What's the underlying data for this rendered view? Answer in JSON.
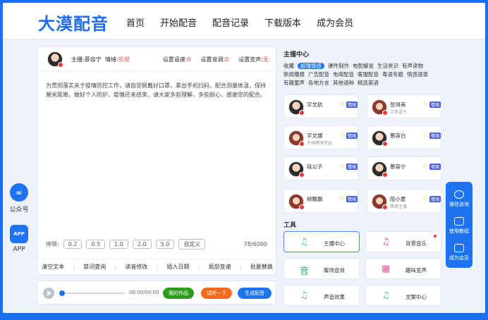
{
  "header": {
    "logo": "大漠配音",
    "nav": [
      "首页",
      "开始配音",
      "配音记录",
      "下载版本",
      "成为会员"
    ]
  },
  "left_side": [
    {
      "icon": "link-icon",
      "label": "公众号",
      "glyph": "∞"
    },
    {
      "icon": "app-icon",
      "label": "APP",
      "glyph": "APP"
    }
  ],
  "editor": {
    "anchor": "主播:慕容宁",
    "emotion_label": "情绪:",
    "emotion_value": "乐观",
    "speed_label": "设置语速:",
    "speed_value": "0",
    "tone_label": "设置音调:",
    "tone_value": "0",
    "vol_label": "设置变声:",
    "vol_value": "无",
    "text": "为贯彻落实关于疫情防控工作，请自觉佩戴好口罩，拿出手机扫码，配合测量体温，保持厘米距离，做好个人防护，疫情还未结束，请大家多些理解，多些耐心，感谢您的配合。",
    "pause_label": "停顿:",
    "pause_options": [
      "0.2",
      "0.5",
      "1.0",
      "2.0",
      "5.0",
      "自定义"
    ],
    "count": "78/6000",
    "tools": [
      "清空文本",
      "禁词查询",
      "读音修改",
      "插入日期",
      "局部变速",
      "批量替换"
    ]
  },
  "player": {
    "time": "00:00/00:00",
    "my_works": "我的作品",
    "try_listen": "试听一下",
    "generate": "生成配音"
  },
  "anchor_center": {
    "title": "主播中心",
    "tags": [
      "收藏",
      "超强情感",
      "课件制作",
      "电影解说",
      "生活常识",
      "有声读物",
      "新闻播报",
      "广告配音",
      "电商配音",
      "客服配音",
      "粤语专题",
      "情感语录",
      "有趣童声",
      "各地方言",
      "其他语种",
      "精选英语"
    ],
    "active_tag": "超强情感",
    "cards": [
      {
        "name": "宇文航",
        "sub": "",
        "female": false
      },
      {
        "name": "张得美",
        "sub": "正常语气",
        "female": true
      },
      {
        "name": "宇文娜",
        "sub": "多种情绪可选",
        "female": true
      },
      {
        "name": "慕容白",
        "sub": "",
        "female": false
      },
      {
        "name": "段公子",
        "sub": "",
        "female": false
      },
      {
        "name": "慕容宁",
        "sub": "",
        "female": false
      },
      {
        "name": "柳飘飘",
        "sub": "",
        "female": true
      },
      {
        "name": "陌小夏",
        "sub": "情绪主播",
        "female": true
      }
    ],
    "star": "☆",
    "badge": "情绪"
  },
  "tools_section": {
    "title": "工具",
    "items": [
      {
        "label": "主播中心",
        "icon": "music-note-icon",
        "glyph": "♫"
      },
      {
        "label": "背景音乐",
        "icon": "music-note-icon",
        "glyph": "♫"
      },
      {
        "label": "暖场音效",
        "icon": "sound-icon",
        "glyph": "音"
      },
      {
        "label": "趣味变声",
        "icon": "calendar-icon",
        "glyph": "▦"
      },
      {
        "label": "声音效果",
        "icon": "music-note-icon",
        "glyph": "♫"
      },
      {
        "label": "文案中心",
        "icon": "music-note-icon",
        "glyph": "♫"
      }
    ]
  },
  "right_side": [
    "微信咨询",
    "使用教程",
    "成为会员"
  ]
}
